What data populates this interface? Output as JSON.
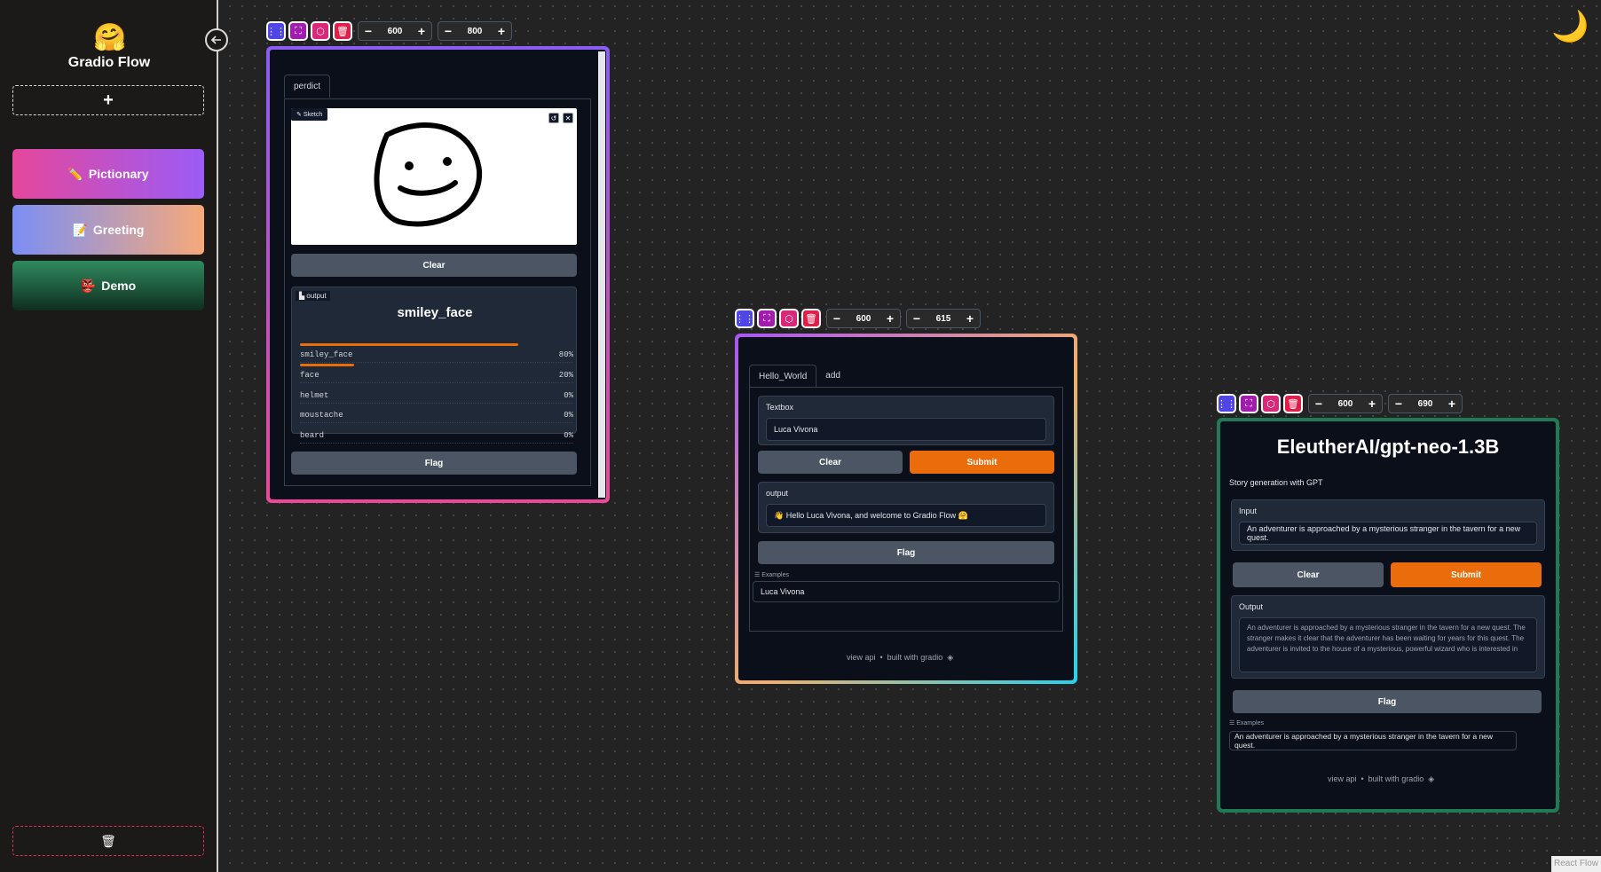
{
  "sidebar": {
    "brand_emoji": "🤗",
    "brand_title": "Gradio Flow",
    "add_label": "+",
    "apps": [
      {
        "icon": "✏️",
        "label": "Pictionary"
      },
      {
        "icon": "📝",
        "label": "Greeting"
      },
      {
        "icon": "👺",
        "label": "Demo"
      }
    ],
    "trash_icon": "🗑"
  },
  "theme_toggle": "🌙",
  "attribution": "React Flow",
  "nodes": [
    {
      "width": "600",
      "height": "800",
      "tab": "perdict",
      "sketch_label": "Sketch",
      "clear_label": "Clear",
      "output_label": "output",
      "prediction": "smiley_face",
      "confidences": [
        {
          "label": "smiley_face",
          "pct": "80%"
        },
        {
          "label": "face",
          "pct": "20%"
        },
        {
          "label": "helmet",
          "pct": "0%"
        },
        {
          "label": "moustache",
          "pct": "0%"
        },
        {
          "label": "beard",
          "pct": "0%"
        }
      ],
      "flag_label": "Flag"
    },
    {
      "width": "600",
      "height": "615",
      "tabs": [
        "Hello_World",
        "add"
      ],
      "textbox_label": "Textbox",
      "textbox_value": "Luca Vivona",
      "clear_label": "Clear",
      "submit_label": "Submit",
      "output_label": "output",
      "output_value": "👋 Hello Luca Vivona, and welcome to Gradio Flow 🤗",
      "flag_label": "Flag",
      "examples_label": "Examples",
      "example_value": "Luca Vivona",
      "view_api": "view api",
      "dot": "•",
      "built_with": "built with gradio"
    },
    {
      "width": "600",
      "height": "690",
      "title": "EleutherAI/gpt-neo-1.3B",
      "description": "Story generation with GPT",
      "input_label": "Input",
      "input_value": "An adventurer is approached by a mysterious stranger in the tavern for a new quest.",
      "clear_label": "Clear",
      "submit_label": "Submit",
      "output_label": "Output",
      "output_value": "An adventurer is approached by a mysterious stranger in the tavern for a new quest. The stranger makes it clear that the adventurer has been waiting for years for this quest. The adventurer is invited to the house of a mysterious, powerful wizard who is interested in",
      "flag_label": "Flag",
      "examples_label": "Examples",
      "example_value": "An adventurer is approached by a mysterious stranger in the tavern for a new quest.",
      "view_api": "view api",
      "dot": "•",
      "built_with": "built with gradio"
    }
  ],
  "colors": {
    "submit": "#ea6c0b",
    "node1_border": "#8b5cf6",
    "node3_border": "#1f7a55"
  }
}
